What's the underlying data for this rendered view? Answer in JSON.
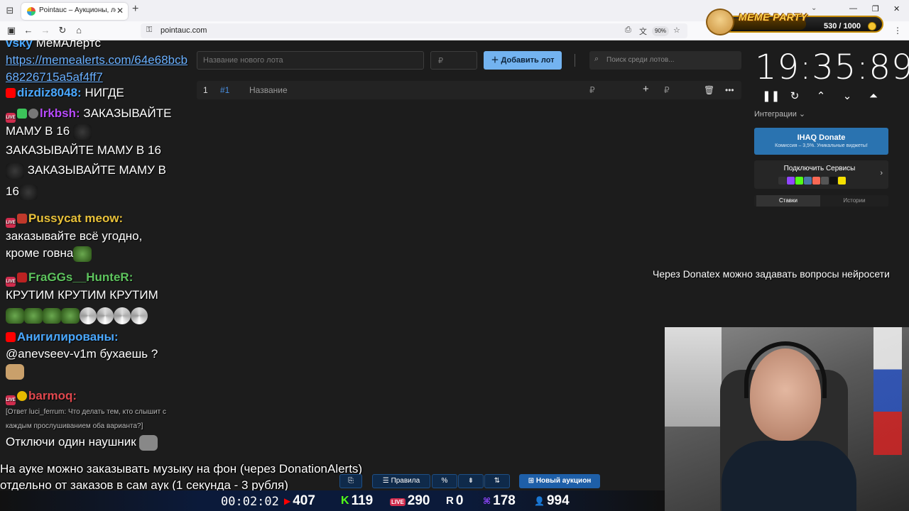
{
  "browser": {
    "tab_title": "Pointauc – Аукционы, лотереи",
    "url": "pointauc.com",
    "zoom": "90%"
  },
  "meme_party": {
    "title": "MEME PARTY",
    "progress_text": "530 / 1000",
    "progress_fraction": 0.53
  },
  "chat": {
    "messages": [
      {
        "user": "vsky",
        "text_lines": [
          "МемАлертс"
        ],
        "link": "https://memealerts.com/64e68bcb68226715a5af4ff7"
      },
      {
        "user": "dizdiz8048:",
        "text": "НИГДЕ",
        "user_color": "#4aa8ff"
      },
      {
        "user": "lrkbsh:",
        "text": "ЗАКАЗЫВАЙТЕ МАМУ В 16",
        "repeat_lines": [
          "ЗАКАЗЫВАЙТЕ МАМУ В 16",
          "ЗАКАЗЫВАЙТЕ МАМУ В",
          "16"
        ],
        "user_color": "#b84aff"
      },
      {
        "user": "Pussycat meow:",
        "text_lines": [
          "заказывайте всё угодно,",
          "кроме говна"
        ],
        "user_color": "#e8c13a"
      },
      {
        "user": "FraGGs__HunteR:",
        "text": "КРУТИМ КРУТИМ КРУТИМ",
        "user_color": "#5ec45e"
      },
      {
        "user": "Анигилированы:",
        "text": "@anevseev-v1m бухаешь ?",
        "user_color": "#4aa8ff"
      },
      {
        "user": "barmoq:",
        "reply": "[Ответ luci_ferrum: Что делать тем, кто слышит с каждым прослушиванием оба варианта?]",
        "text": "Отключи один наушник",
        "user_color": "#e0484e"
      }
    ]
  },
  "app": {
    "lot_name_placeholder": "Название нового лота",
    "amount_placeholder": "₽",
    "add_lot_label": "Добавить лот",
    "search_placeholder": "Поиск среди лотов...",
    "lot_row": {
      "index": "1",
      "id": "#1",
      "name": "Название",
      "currency": "₽",
      "currency2": "₽"
    },
    "timer": "19:35:89",
    "integrations_label": "Интеграции",
    "ihaq_title": "IHAQ Donate",
    "ihaq_subtitle": "Комиссия – 3,5%. Уникальные виджеты!",
    "services_label": "Подключить Сервисы",
    "tabs": [
      "Ставки",
      "Истории"
    ],
    "bottom_buttons": {
      "rules": "Правила",
      "new_auction": "Новый аукцион"
    }
  },
  "overlay": {
    "donatex_text": "Через Donatex можно задавать вопросы нейросети",
    "music_line1": "На ауке можно заказывать музыку на фон (через DonationAlerts)",
    "music_line2": "отдельно от заказов в сам аук (1 секунда - 3 рубля)"
  },
  "stats": {
    "uptime": "00:02:02",
    "youtube": "407",
    "kick": "119",
    "live": "290",
    "rumble": "0",
    "twitch": "178",
    "total": "994"
  },
  "colors": {
    "accent_button": "#73b3f0",
    "ihaq": "#2a73b0",
    "new_auction": "#1e5fa8"
  }
}
